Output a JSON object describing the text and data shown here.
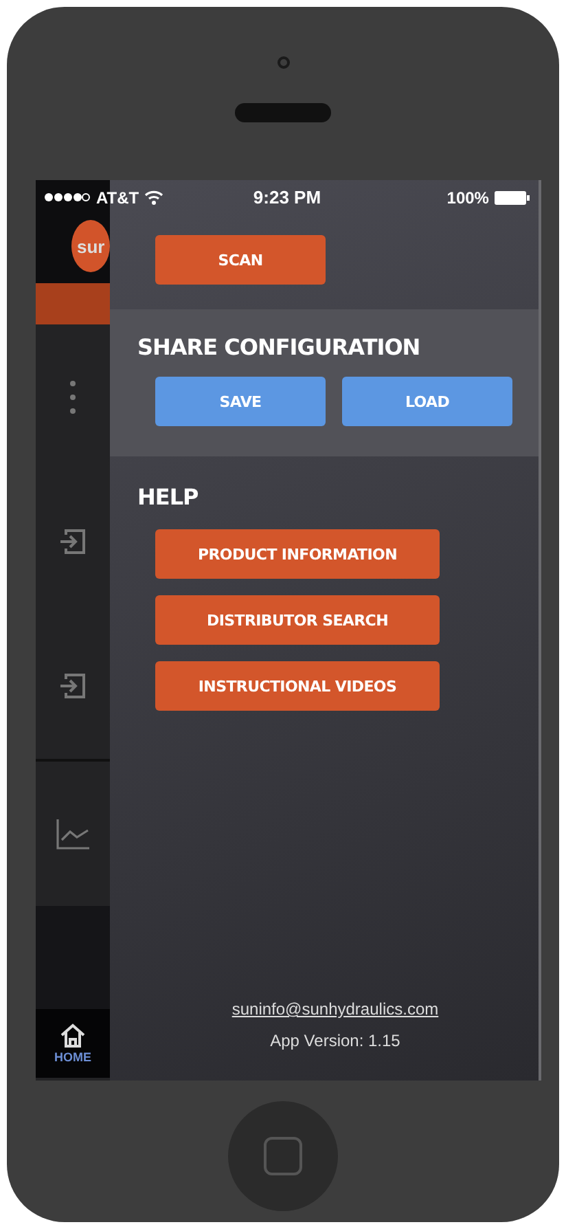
{
  "status_bar": {
    "carrier": "AT&T",
    "time": "9:23 PM",
    "battery": "100%"
  },
  "sidebar": {
    "logo": "sur",
    "home_label": "HOME"
  },
  "drawer": {
    "scan_button": "SCAN",
    "share": {
      "title": "SHARE CONFIGURATION",
      "buttons": [
        "SAVE",
        "LOAD"
      ]
    },
    "help": {
      "title": "HELP",
      "buttons": [
        "PRODUCT INFORMATION",
        "DISTRIBUTOR SEARCH",
        "INSTRUCTIONAL VIDEOS"
      ]
    },
    "email": "suninfo@sunhydraulics.com",
    "version": "App Version: 1.15"
  }
}
